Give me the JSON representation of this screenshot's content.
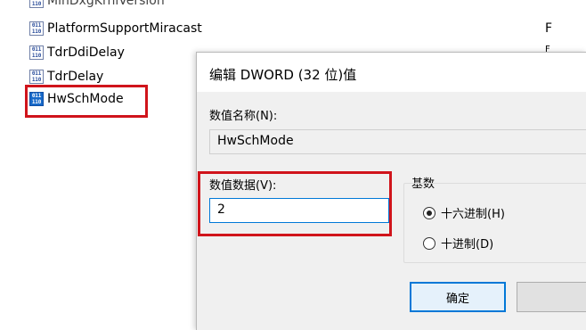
{
  "registry": {
    "items": [
      {
        "label": "MinDxgKrnlVersion"
      },
      {
        "label": "PlatformSupportMiracast"
      },
      {
        "label": "TdrDdiDelay"
      },
      {
        "label": "TdrDelay"
      },
      {
        "label": "HwSchMode"
      }
    ],
    "right_column": [
      "F",
      "F"
    ]
  },
  "dialog": {
    "title": "编辑 DWORD (32 位)值",
    "name_label": "数值名称(N):",
    "name_value": "HwSchMode",
    "data_label": "数值数据(V):",
    "data_value": "2",
    "base_label": "基数",
    "radio_hex": "十六进制(H)",
    "radio_dec": "十进制(D)",
    "ok_button": "确定",
    "cancel_button": ""
  },
  "colors": {
    "highlight": "#d0141b",
    "accent": "#0078d7"
  }
}
